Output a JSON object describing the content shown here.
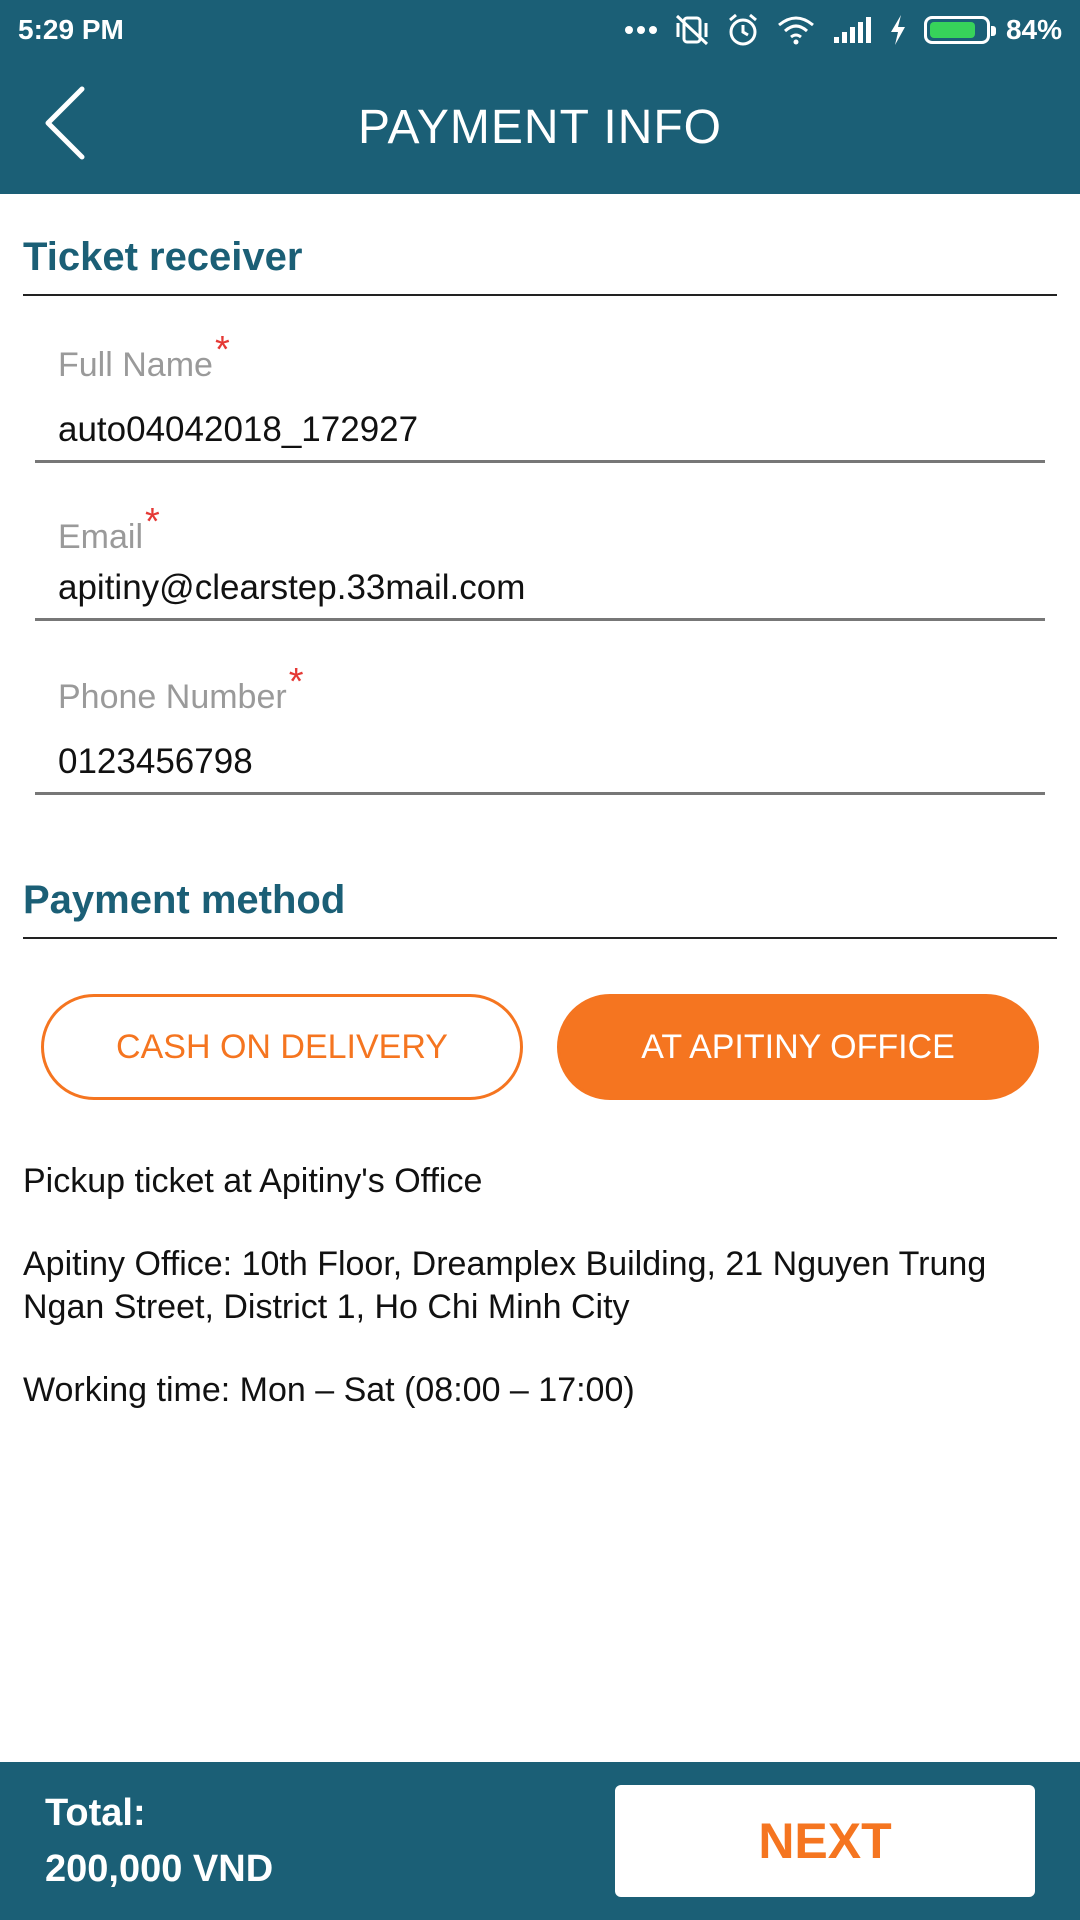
{
  "status_bar": {
    "time": "5:29 PM",
    "battery_percent": "84%",
    "battery_level": 0.84,
    "icons": [
      "more-dots-icon",
      "vibrate-off-icon",
      "alarm-icon",
      "wifi-icon",
      "signal-icon",
      "charging-icon",
      "battery-icon"
    ]
  },
  "header": {
    "title": "PAYMENT INFO"
  },
  "ticket_receiver": {
    "section_title": "Ticket receiver",
    "full_name": {
      "label": "Full Name",
      "required": "*",
      "value": "auto04042018_172927"
    },
    "email": {
      "label": "Email",
      "required": "*",
      "value": "apitiny@clearstep.33mail.com"
    },
    "phone": {
      "label": "Phone Number",
      "required": "*",
      "value": "0123456798"
    }
  },
  "payment_method": {
    "section_title": "Payment method",
    "cash_on_delivery_label": "CASH ON DELIVERY",
    "office_label": "AT APITINY OFFICE",
    "selected": "AT APITINY OFFICE"
  },
  "pickup_info": {
    "line1": "Pickup ticket at Apitiny's Office",
    "line2": "Apitiny Office: 10th Floor, Dreamplex Building, 21 Nguyen Trung Ngan Street, District 1, Ho Chi Minh City",
    "line3": "Working time: Mon – Sat (08:00 – 17:00)"
  },
  "footer": {
    "total_label": "Total:",
    "total_value": "200,000 VND",
    "next_label": "NEXT"
  },
  "colors": {
    "primary": "#1b5f76",
    "accent": "#f57520",
    "required": "#e53935",
    "battery": "#37d35a"
  }
}
